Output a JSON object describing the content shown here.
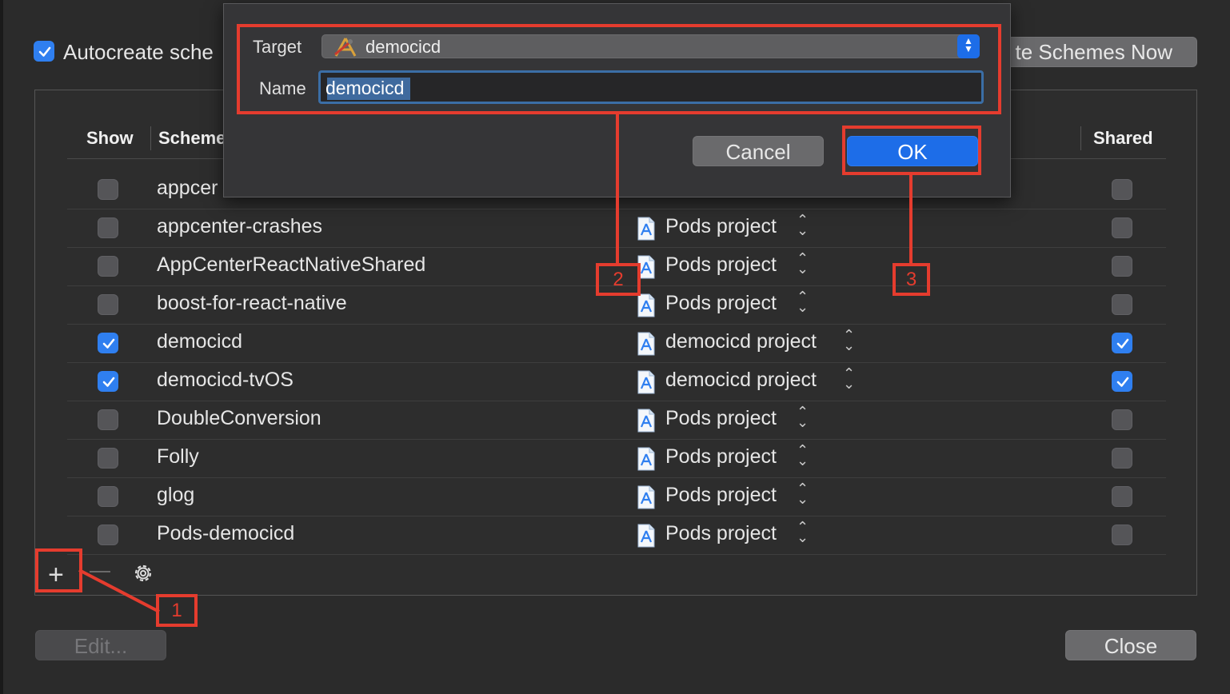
{
  "autocreate": {
    "label": "Autocreate sche",
    "checked": true
  },
  "buttons": {
    "autocreate_now": "te Schemes Now",
    "edit": "Edit...",
    "close": "Close",
    "cancel": "Cancel",
    "ok": "OK"
  },
  "table": {
    "headers": {
      "show": "Show",
      "scheme": "Scheme",
      "shared": "Shared"
    },
    "partial_row_name": "appcer",
    "rows": [
      {
        "show": false,
        "name": "appcenter-crashes",
        "container": "Pods project",
        "shared": false
      },
      {
        "show": false,
        "name": "AppCenterReactNativeShared",
        "container": "Pods project",
        "shared": false
      },
      {
        "show": false,
        "name": "boost-for-react-native",
        "container": "Pods project",
        "shared": false
      },
      {
        "show": true,
        "name": "democicd",
        "container": "democicd project",
        "shared": true
      },
      {
        "show": true,
        "name": "democicd-tvOS",
        "container": "democicd project",
        "shared": true
      },
      {
        "show": false,
        "name": "DoubleConversion",
        "container": "Pods project",
        "shared": false
      },
      {
        "show": false,
        "name": "Folly",
        "container": "Pods project",
        "shared": false
      },
      {
        "show": false,
        "name": "glog",
        "container": "Pods project",
        "shared": false
      },
      {
        "show": false,
        "name": "Pods-democicd",
        "container": "Pods project",
        "shared": false
      }
    ]
  },
  "toolbar": {
    "add_icon": "plus-icon",
    "remove_icon": "minus-icon",
    "settings_icon": "gear-icon"
  },
  "dialog": {
    "target_label": "Target",
    "target_value": "democicd",
    "name_label": "Name",
    "name_value": "democicd"
  },
  "annotations": {
    "one": "1",
    "two": "2",
    "three": "3"
  },
  "colors": {
    "accent": "#1d6de8",
    "annotation": "#e53c2e",
    "background": "#2b2b2b"
  }
}
